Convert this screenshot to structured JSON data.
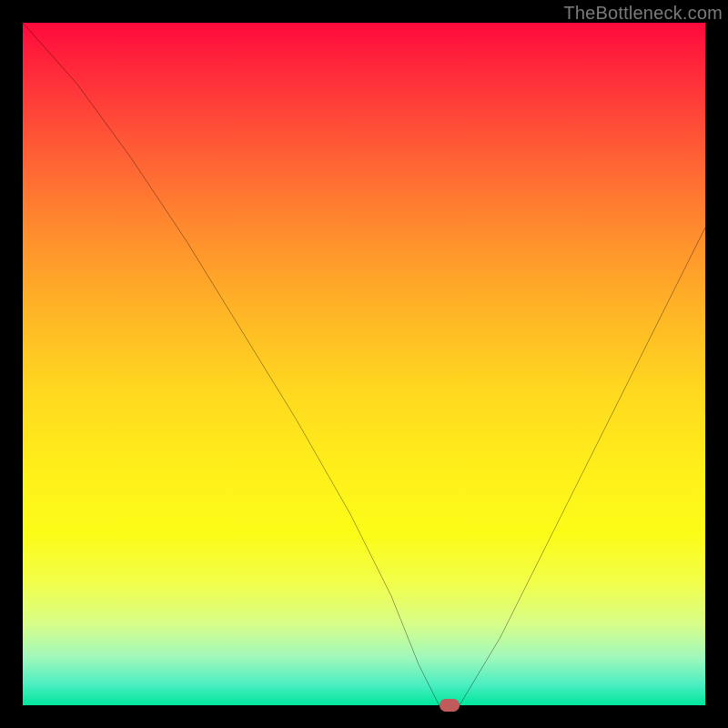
{
  "watermark": "TheBottleneck.com",
  "chart_data": {
    "type": "line",
    "title": "",
    "xlabel": "",
    "ylabel": "",
    "xlim": [
      0,
      100
    ],
    "ylim": [
      0,
      100
    ],
    "series": [
      {
        "name": "bottleneck-curve",
        "x": [
          0,
          8,
          16,
          24,
          32,
          40,
          48,
          54,
          58,
          61,
          64,
          70,
          76,
          82,
          88,
          94,
          100
        ],
        "y": [
          100,
          91,
          80,
          68,
          55,
          42,
          28,
          16,
          6,
          0,
          0,
          10,
          22,
          34,
          46,
          58,
          70
        ]
      }
    ],
    "marker": {
      "x": 62.5,
      "y": 0,
      "label": "optimal-point"
    },
    "colors": {
      "curve": "#000000",
      "marker": "#c15a5a",
      "gradient_top": "#ff0a3c",
      "gradient_bottom": "#00e69c",
      "background": "#000000"
    }
  }
}
